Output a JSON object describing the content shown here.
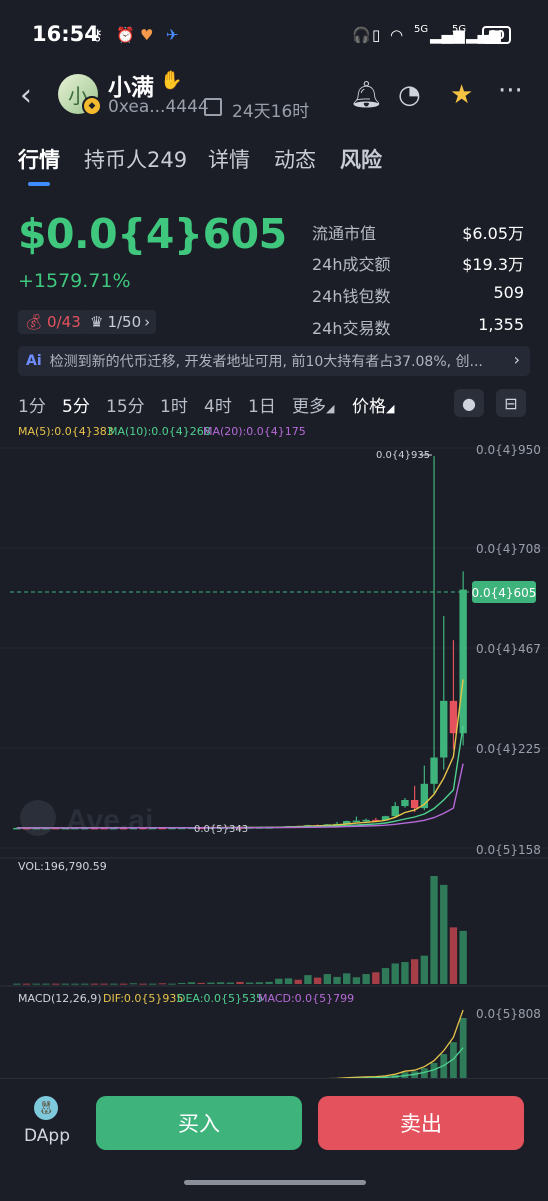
{
  "status": {
    "time": "16:54",
    "battery": "60",
    "net1": "5G",
    "net2": "5G"
  },
  "header": {
    "avatar_char": "小",
    "name": "小满",
    "address": "0xea...4444",
    "age": "24天16时"
  },
  "tabs": [
    "行情",
    "持币人249",
    "详情",
    "动态",
    "风险"
  ],
  "price": {
    "value": "$0.0{4}605",
    "change": "+1579.71%"
  },
  "chips": {
    "sniper": "0/43",
    "rank": "1/50"
  },
  "stats": [
    {
      "label": "流通市值",
      "value": "$6.05万"
    },
    {
      "label": "24h成交额",
      "value": "$19.3万"
    },
    {
      "label": "24h钱包数",
      "value": "509"
    },
    {
      "label": "24h交易数",
      "value": "1,355"
    }
  ],
  "notice": {
    "badge": "Ai",
    "text": "检测到新的代币迁移, 开发者地址可用, 前10大持有者占37.08%, 创..."
  },
  "timeframes": [
    "1分",
    "5分",
    "15分",
    "1时",
    "4时",
    "1日",
    "更多",
    "价格"
  ],
  "ma_legend": [
    {
      "label": "MA(5):0.0{4}383",
      "color": "#e6c34a"
    },
    {
      "label": "MA(10):0.0{4}268",
      "color": "#4fd08f"
    },
    {
      "label": "MA(20):0.0{4}175",
      "color": "#b66ad8"
    }
  ],
  "price_axis": [
    "0.0{4}950",
    "0.0{4}708",
    "0.0{4}467",
    "0.0{4}225",
    "0.0{5}158"
  ],
  "current_price_tag": "0.0{4}605",
  "annotations": {
    "high": "0.0{4}935",
    "low": "0.0{5}343"
  },
  "watermark": "Ave.ai",
  "volume_label": "VOL:196,790.59",
  "macd": {
    "title": "MACD(12,26,9)",
    "dif": "DIF:0.0{5}935",
    "dea": "DEA:0.0{5}535",
    "macd": "MACD:0.0{5}799",
    "axis": "0.0{5}808"
  },
  "colors": {
    "up": "#3fb37c",
    "down": "#e4525d",
    "accent": "#3f8cff"
  },
  "chart_data": {
    "type": "candlestick",
    "interval": "5分",
    "price_unit": "1e-5",
    "candles": [
      {
        "o": 1.6,
        "h": 1.62,
        "l": 1.58,
        "c": 1.61
      },
      {
        "o": 1.61,
        "h": 1.63,
        "l": 1.59,
        "c": 1.6
      },
      {
        "o": 1.6,
        "h": 1.62,
        "l": 1.58,
        "c": 1.61
      },
      {
        "o": 1.61,
        "h": 1.64,
        "l": 1.59,
        "c": 1.62
      },
      {
        "o": 1.62,
        "h": 1.63,
        "l": 1.59,
        "c": 1.6
      },
      {
        "o": 1.6,
        "h": 1.62,
        "l": 1.58,
        "c": 1.61
      },
      {
        "o": 1.61,
        "h": 1.63,
        "l": 1.6,
        "c": 1.62
      },
      {
        "o": 1.62,
        "h": 1.64,
        "l": 1.6,
        "c": 1.63
      },
      {
        "o": 1.63,
        "h": 1.64,
        "l": 1.61,
        "c": 1.62
      },
      {
        "o": 1.62,
        "h": 1.63,
        "l": 1.6,
        "c": 1.61
      },
      {
        "o": 1.61,
        "h": 1.64,
        "l": 1.6,
        "c": 1.63
      },
      {
        "o": 1.63,
        "h": 1.65,
        "l": 1.61,
        "c": 1.62
      },
      {
        "o": 1.62,
        "h": 1.66,
        "l": 1.6,
        "c": 1.65
      },
      {
        "o": 1.65,
        "h": 1.66,
        "l": 1.62,
        "c": 1.63
      },
      {
        "o": 1.63,
        "h": 1.65,
        "l": 1.61,
        "c": 1.64
      },
      {
        "o": 1.64,
        "h": 1.66,
        "l": 1.62,
        "c": 1.63
      },
      {
        "o": 1.63,
        "h": 1.65,
        "l": 1.61,
        "c": 1.64
      },
      {
        "o": 1.64,
        "h": 1.66,
        "l": 1.62,
        "c": 1.65
      },
      {
        "o": 1.65,
        "h": 1.7,
        "l": 1.63,
        "c": 1.68
      },
      {
        "o": 1.68,
        "h": 1.72,
        "l": 1.65,
        "c": 1.66
      },
      {
        "o": 1.66,
        "h": 1.72,
        "l": 1.64,
        "c": 1.7
      },
      {
        "o": 1.7,
        "h": 1.74,
        "l": 1.68,
        "c": 1.71
      },
      {
        "o": 1.71,
        "h": 1.75,
        "l": 1.69,
        "c": 1.73
      },
      {
        "o": 1.73,
        "h": 1.76,
        "l": 1.7,
        "c": 1.72
      },
      {
        "o": 1.72,
        "h": 1.76,
        "l": 1.7,
        "c": 1.75
      },
      {
        "o": 1.75,
        "h": 1.78,
        "l": 1.73,
        "c": 1.77
      },
      {
        "o": 1.77,
        "h": 1.8,
        "l": 1.75,
        "c": 1.78
      },
      {
        "o": 1.78,
        "h": 1.95,
        "l": 1.75,
        "c": 1.93
      },
      {
        "o": 1.93,
        "h": 2.1,
        "l": 1.88,
        "c": 2.05
      },
      {
        "o": 2.05,
        "h": 2.15,
        "l": 1.98,
        "c": 2.02
      },
      {
        "o": 2.02,
        "h": 2.4,
        "l": 1.98,
        "c": 2.3
      },
      {
        "o": 2.3,
        "h": 2.45,
        "l": 2.1,
        "c": 2.2
      },
      {
        "o": 2.2,
        "h": 2.55,
        "l": 2.15,
        "c": 2.5
      },
      {
        "o": 2.5,
        "h": 3.1,
        "l": 2.4,
        "c": 2.6
      },
      {
        "o": 2.6,
        "h": 3.4,
        "l": 2.55,
        "c": 3.3
      },
      {
        "o": 3.3,
        "h": 4.4,
        "l": 3.05,
        "c": 3.4
      },
      {
        "o": 3.4,
        "h": 3.9,
        "l": 3.2,
        "c": 3.6
      },
      {
        "o": 3.6,
        "h": 4.1,
        "l": 3.3,
        "c": 3.5
      },
      {
        "o": 3.5,
        "h": 4.6,
        "l": 3.4,
        "c": 4.5
      },
      {
        "o": 4.5,
        "h": 8.0,
        "l": 4.2,
        "c": 7.0
      },
      {
        "o": 7.0,
        "h": 9.0,
        "l": 6.6,
        "c": 8.5
      },
      {
        "o": 8.5,
        "h": 12.0,
        "l": 5.5,
        "c": 6.5
      },
      {
        "o": 6.5,
        "h": 17.0,
        "l": 6.0,
        "c": 12.5
      },
      {
        "o": 12.5,
        "h": 93.5,
        "l": 10.0,
        "c": 19.0
      },
      {
        "o": 19.0,
        "h": 54.0,
        "l": 16.0,
        "c": 33.0
      },
      {
        "o": 33.0,
        "h": 48.0,
        "l": 21.0,
        "c": 25.0
      },
      {
        "o": 25.0,
        "h": 65.0,
        "l": 22.0,
        "c": 60.5
      }
    ],
    "volumes": [
      1,
      1,
      1,
      1,
      1,
      1,
      1,
      1,
      1,
      1,
      1,
      1,
      2,
      1,
      1,
      2,
      1,
      3,
      5,
      3,
      4,
      5,
      4,
      6,
      4,
      5,
      6,
      15,
      16,
      12,
      25,
      18,
      28,
      20,
      30,
      19,
      28,
      33,
      45,
      58,
      62,
      70,
      80,
      305,
      280,
      160,
      150
    ],
    "ylim": [
      1.58,
      95.0
    ],
    "ma": {
      "ma5": [
        1.61,
        1.61,
        1.61,
        1.61,
        1.61,
        1.61,
        1.62,
        1.62,
        1.62,
        1.62,
        1.62,
        1.62,
        1.63,
        1.63,
        1.63,
        1.63,
        1.64,
        1.64,
        1.65,
        1.66,
        1.67,
        1.68,
        1.7,
        1.71,
        1.72,
        1.74,
        1.75,
        1.79,
        1.86,
        1.93,
        2.03,
        2.12,
        2.21,
        2.32,
        2.58,
        2.8,
        3.0,
        3.16,
        3.48,
        4.22,
        5.42,
        6.0,
        7.44,
        9.89,
        13.9,
        19.2,
        38.3
      ],
      "ma10": [
        1.61,
        1.61,
        1.61,
        1.61,
        1.61,
        1.61,
        1.61,
        1.61,
        1.62,
        1.62,
        1.62,
        1.62,
        1.62,
        1.62,
        1.63,
        1.63,
        1.63,
        1.63,
        1.64,
        1.64,
        1.65,
        1.66,
        1.67,
        1.68,
        1.69,
        1.7,
        1.71,
        1.74,
        1.78,
        1.82,
        1.88,
        1.93,
        1.99,
        2.05,
        2.18,
        2.3,
        2.45,
        2.6,
        2.82,
        3.27,
        3.8,
        4.3,
        5.05,
        6.4,
        8.5,
        11.0,
        26.8
      ],
      "ma20": [
        1.61,
        1.61,
        1.61,
        1.61,
        1.61,
        1.61,
        1.61,
        1.61,
        1.61,
        1.61,
        1.61,
        1.61,
        1.62,
        1.62,
        1.62,
        1.62,
        1.62,
        1.62,
        1.63,
        1.63,
        1.63,
        1.64,
        1.64,
        1.65,
        1.65,
        1.66,
        1.67,
        1.68,
        1.7,
        1.72,
        1.75,
        1.78,
        1.81,
        1.85,
        1.92,
        1.99,
        2.07,
        2.15,
        2.26,
        2.5,
        2.8,
        3.08,
        3.48,
        4.15,
        5.2,
        6.5,
        17.5
      ]
    }
  }
}
